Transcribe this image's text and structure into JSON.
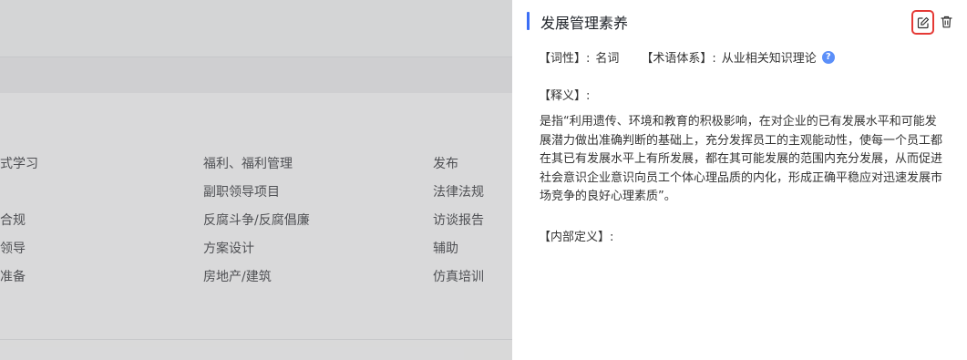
{
  "background_table": {
    "columns": [
      [
        "式学习",
        "",
        "合规",
        "领导",
        "准备"
      ],
      [
        "福利、福利管理",
        "副职领导项目",
        "反腐斗争/反腐倡廉",
        "方案设计",
        "房地产/建筑"
      ],
      [
        "发布",
        "法律法规",
        "访谈报告",
        "辅助",
        "仿真培训"
      ]
    ]
  },
  "drawer": {
    "title": "发展管理素养",
    "edit_icon": "edit-icon",
    "delete_icon": "trash-icon",
    "part_of_speech_label": "【词性】:",
    "part_of_speech_value": "名词",
    "term_system_label": "【术语体系】:",
    "term_system_value": "从业相关知识理论",
    "help_glyph": "?",
    "definition_label": "【释义】:",
    "definition_text": "是指“利用遗传、环境和教育的积极影响，在对企业的已有发展水平和可能发展潜力做出准确判断的基础上，充分发挥员工的主观能动性，使每一个员工都在其已有发展水平上有所发展，都在其可能发展的范围内充分发展，从而促进社会意识企业意识向员工个体心理品质的内化，形成正确平稳应对迅速发展市场竞争的良好心理素质”。",
    "internal_def_label": "【内部定义】:",
    "accent_color": "#3b6ef5",
    "highlight_color": "#e53935"
  }
}
